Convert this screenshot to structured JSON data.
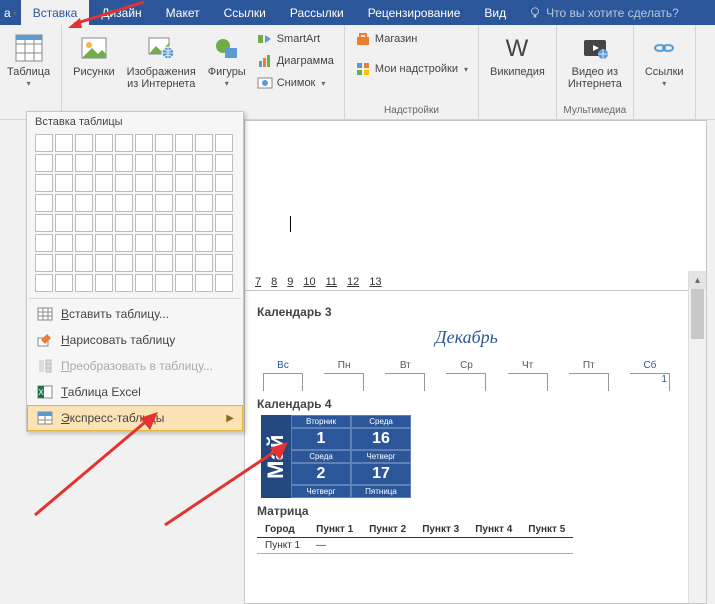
{
  "tabs": {
    "partial": "а",
    "items": [
      "Вставка",
      "Дизайн",
      "Макет",
      "Ссылки",
      "Рассылки",
      "Рецензирование",
      "Вид"
    ],
    "active_index": 0,
    "tell_me": "Что вы хотите сделать?"
  },
  "ribbon": {
    "table": {
      "label": "Таблица"
    },
    "illustrations": {
      "pictures": "Рисунки",
      "online_pic1": "Изображения",
      "online_pic2": "из Интернета",
      "shapes": "Фигуры",
      "smartart": "SmartArt",
      "chart": "Диаграмма",
      "screenshot": "Снимок"
    },
    "addins": {
      "store": "Магазин",
      "myaddins": "Мои надстройки",
      "group": "Надстройки"
    },
    "wiki": {
      "label": "Википедия"
    },
    "media": {
      "label1": "Видео из",
      "label2": "Интернета",
      "group": "Мультимедиа"
    },
    "links": {
      "label": "Ссылки"
    }
  },
  "dropdown": {
    "title": "Вставка таблицы",
    "insert": "Вставить таблицу...",
    "draw": "Нарисовать таблицу",
    "convert": "Преобразовать в таблицу...",
    "excel": "Таблица Excel",
    "quick": "Экспресс-таблицы"
  },
  "panel": {
    "ruler": [
      "7",
      "8",
      "9",
      "10",
      "11",
      "12",
      "13"
    ],
    "cal3": {
      "title": "Календарь 3",
      "month": "Декабрь",
      "days": [
        "Вс",
        "Пн",
        "Вт",
        "Ср",
        "Чт",
        "Пт",
        "Сб"
      ],
      "first": "1"
    },
    "cal4": {
      "title": "Календарь 4",
      "month": "Май",
      "rows": [
        [
          "Вторник",
          "Среда"
        ],
        [
          "1",
          "16"
        ],
        [
          "Среда",
          "Четверг"
        ],
        [
          "2",
          "17"
        ],
        [
          "Четверг",
          "Пятница"
        ]
      ]
    },
    "matrix": {
      "title": "Матрица",
      "headers": [
        "Город",
        "Пункт 1",
        "Пункт 2",
        "Пункт 3",
        "Пункт 4",
        "Пункт 5"
      ],
      "row": [
        "Пункт 1",
        "—",
        "",
        "",
        "",
        ""
      ]
    }
  }
}
